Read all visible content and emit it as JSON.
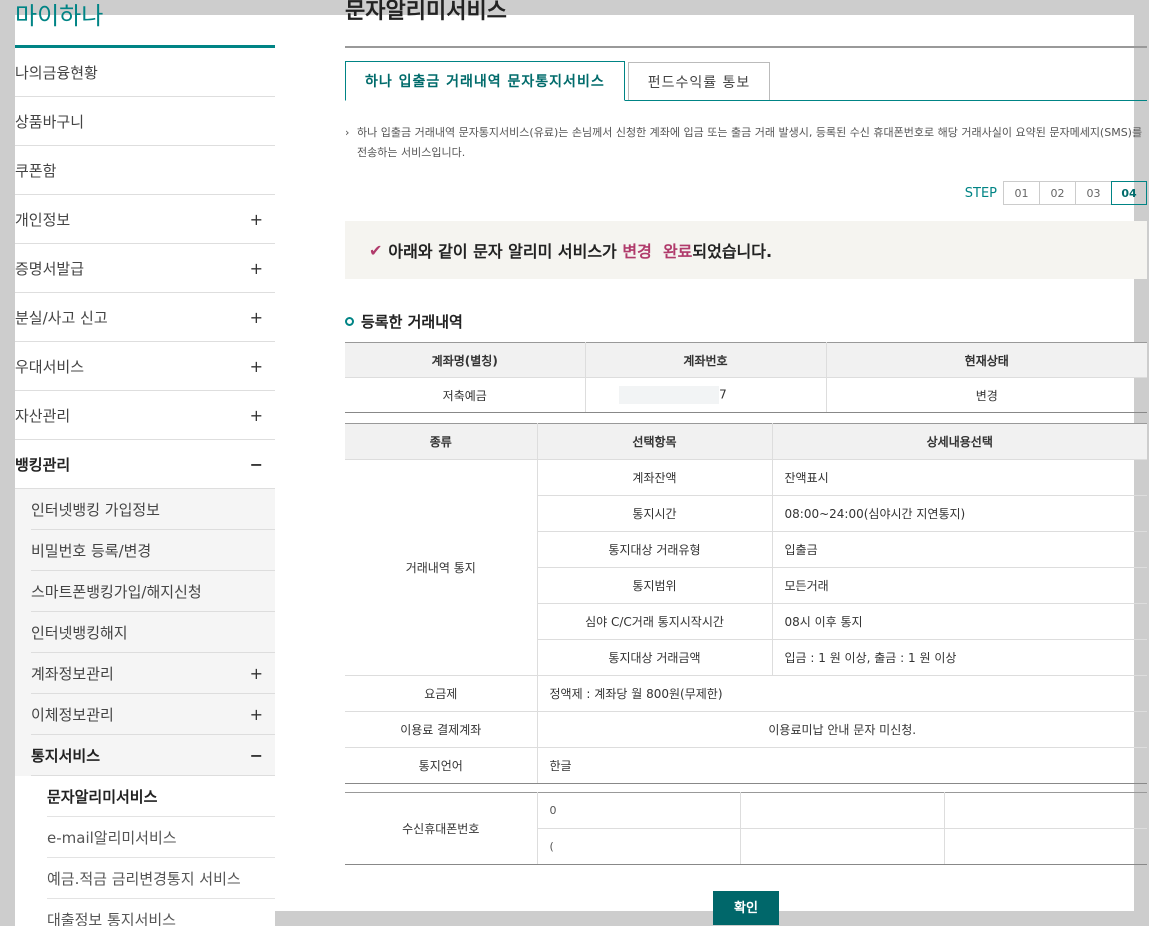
{
  "sidebar": {
    "brand": "마이하나",
    "items": [
      {
        "label": "나의금융현황",
        "toggle": ""
      },
      {
        "label": "상품바구니",
        "toggle": ""
      },
      {
        "label": "쿠폰함",
        "toggle": ""
      },
      {
        "label": "개인정보",
        "toggle": "+"
      },
      {
        "label": "증명서발급",
        "toggle": "+"
      },
      {
        "label": "분실/사고 신고",
        "toggle": "+"
      },
      {
        "label": "우대서비스",
        "toggle": "+"
      },
      {
        "label": "자산관리",
        "toggle": "+"
      },
      {
        "label": "뱅킹관리",
        "toggle": "−"
      }
    ],
    "banking_sub": [
      {
        "label": "인터넷뱅킹 가입정보",
        "toggle": ""
      },
      {
        "label": "비밀번호 등록/변경",
        "toggle": ""
      },
      {
        "label": "스마트폰뱅킹가입/해지신청",
        "toggle": ""
      },
      {
        "label": "인터넷뱅킹해지",
        "toggle": ""
      },
      {
        "label": "계좌정보관리",
        "toggle": "+"
      },
      {
        "label": "이체정보관리",
        "toggle": "+"
      },
      {
        "label": "통지서비스",
        "toggle": "−"
      }
    ],
    "notice_sub": [
      "문자알리미서비스",
      "e-mail알리미서비스",
      "예금.적금 금리변경통지 서비스",
      "대출정보 통지서비스"
    ]
  },
  "main": {
    "title": "문자알리미서비스",
    "tabs": [
      "하나 입출금 거래내역 문자통지서비스",
      "펀드수익률 통보"
    ],
    "description": "하나 입출금 거래내역 문자통지서비스(유료)는 손님께서 신청한 계좌에 입금 또는 출금 거래 발생시, 등록된 수신 휴대폰번호로 해당 거래사실이 요약된 문자메세지(SMS)를 전송하는 서비스입니다.",
    "step_label": "STEP",
    "steps": [
      "01",
      "02",
      "03",
      "04"
    ],
    "notice_pre": "아래와 같이 문자 알리미 서비스가",
    "notice_hl": "변경  완료",
    "notice_post": "되었습니다.",
    "section_title": "등록한 거래내역",
    "account_table": {
      "headers": [
        "계좌명(별칭)",
        "계좌번호",
        "현재상태"
      ],
      "row": {
        "name": "저축예금",
        "number_tail": "7",
        "status": "변경"
      }
    },
    "detail_table": {
      "headers": [
        "종류",
        "선택항목",
        "상세내용선택"
      ],
      "group_label": "거래내역 통지",
      "rows": [
        {
          "item": "계좌잔액",
          "value": "잔액표시"
        },
        {
          "item": "통지시간",
          "value": "08:00~24:00(심야시간 지연통지)"
        },
        {
          "item": "통지대상 거래유형",
          "value": "입출금"
        },
        {
          "item": "통지범위",
          "value": "모든거래"
        },
        {
          "item": "심야 C/C거래 통지시작시간",
          "value": "08시 이후 통지"
        },
        {
          "item": "통지대상 거래금액",
          "value": "입금 : 1 원 이상, 출금 : 1 원 이상"
        }
      ],
      "plan_label": "요금제",
      "plan_value": "정액제 : 계좌당 월 800원(무제한)",
      "pay_label": "이용료 결제계좌",
      "pay_value": "이용료미납 안내 문자 미신청.",
      "lang_label": "통지언어",
      "lang_value": "한글"
    },
    "phone_table": {
      "label": "수신휴대폰번호",
      "phone1": "0",
      "phone2": "("
    },
    "confirm_button": "확인"
  }
}
